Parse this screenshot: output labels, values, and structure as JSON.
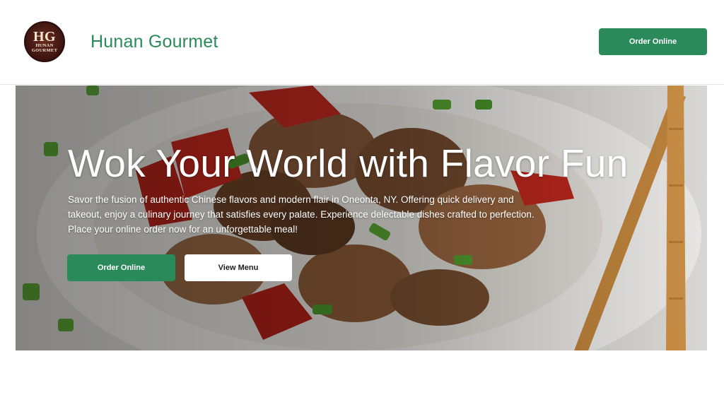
{
  "header": {
    "logo": {
      "initials": "HG",
      "line1": "HUNAN",
      "line2": "GOURMET"
    },
    "brand_name": "Hunan Gourmet",
    "order_button": "Order Online"
  },
  "hero": {
    "title": "Wok Your World with Flavor Fun",
    "description": "Savor the fusion of authentic Chinese flavors and modern flair in Oneonta, NY. Offering quick delivery and takeout, enjoy a culinary journey that satisfies every palate. Experience delectable dishes crafted to perfection. Place your online order now for an unforgettable meal!",
    "primary_button": "Order Online",
    "secondary_button": "View Menu"
  },
  "colors": {
    "brand_green": "#2a8a5a",
    "white": "#ffffff",
    "logo_brown": "#4a1a12"
  }
}
